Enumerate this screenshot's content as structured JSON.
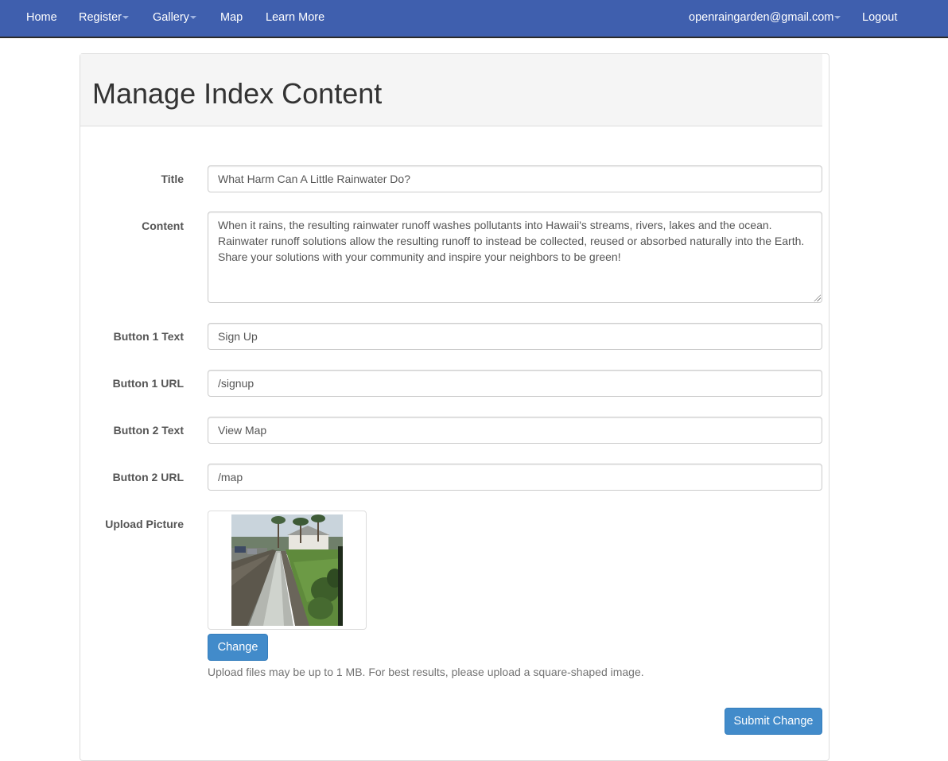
{
  "navbar": {
    "home": "Home",
    "register": "Register",
    "gallery": "Gallery",
    "map": "Map",
    "learn_more": "Learn More",
    "user_email": "openraingarden@gmail.com",
    "logout": "Logout"
  },
  "panel": {
    "title": "Manage Index Content"
  },
  "form": {
    "title_label": "Title",
    "title_value": "What Harm Can A Little Rainwater Do?",
    "content_label": "Content",
    "content_value": "When it rains, the resulting rainwater runoff washes pollutants into Hawaii's streams, rivers, lakes and the ocean. Rainwater runoff solutions allow the resulting runoff to instead be collected, reused or absorbed naturally into the Earth. Share your solutions with your community and inspire your neighbors to be green!",
    "button1_text_label": "Button 1 Text",
    "button1_text_value": "Sign Up",
    "button1_url_label": "Button 1 URL",
    "button1_url_value": "/signup",
    "button2_text_label": "Button 2 Text",
    "button2_text_value": "View Map",
    "button2_url_label": "Button 2 URL",
    "button2_url_value": "/map",
    "upload_label": "Upload Picture",
    "change_button": "Change",
    "upload_help": "Upload files may be up to 1 MB. For best results, please upload a square-shaped image.",
    "submit_button": "Submit Change"
  },
  "colors": {
    "navbar": "#3f5fae",
    "primary_button": "#428bca"
  }
}
